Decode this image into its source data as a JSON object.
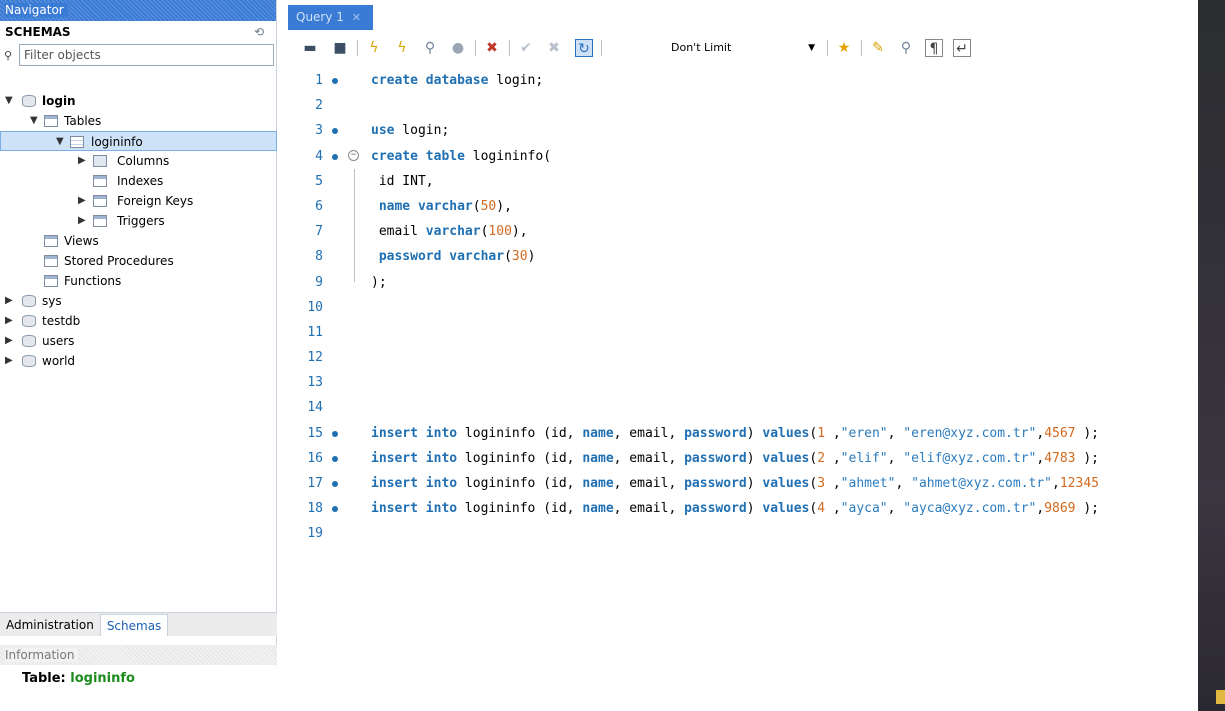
{
  "navigator": {
    "title": "Navigator",
    "schemas_label": "SCHEMAS",
    "filter_placeholder": "Filter objects",
    "tree": {
      "login": "login",
      "tables": "Tables",
      "logininfo": "logininfo",
      "columns": "Columns",
      "indexes": "Indexes",
      "foreign_keys": "Foreign Keys",
      "triggers": "Triggers",
      "views": "Views",
      "stored_procedures": "Stored Procedures",
      "functions": "Functions",
      "sys": "sys",
      "testdb": "testdb",
      "users": "users",
      "world": "world"
    },
    "bottom_tabs": [
      "Administration",
      "Schemas"
    ],
    "information_title": "Information",
    "info_table_prefix": "Table:",
    "info_table_name": "logininfo"
  },
  "editor": {
    "tab_title": "Query 1",
    "limit": "Don't Limit",
    "lines": [
      {
        "n": "1",
        "text": "create database login;"
      },
      {
        "n": "2",
        "text": ""
      },
      {
        "n": "3",
        "text": "use login;"
      },
      {
        "n": "4",
        "text": "create table logininfo("
      },
      {
        "n": "5",
        "text": " id INT,"
      },
      {
        "n": "6",
        "text": " name varchar(50),"
      },
      {
        "n": "7",
        "text": " email varchar(100),"
      },
      {
        "n": "8",
        "text": " password varchar(30)"
      },
      {
        "n": "9",
        "text": ");"
      },
      {
        "n": "10",
        "text": ""
      },
      {
        "n": "11",
        "text": ""
      },
      {
        "n": "12",
        "text": ""
      },
      {
        "n": "13",
        "text": ""
      },
      {
        "n": "14",
        "text": ""
      },
      {
        "n": "15",
        "text": "insert into logininfo (id, name, email, password) values(1 ,\"eren\", \"eren@xyz.com.tr\",4567 );"
      },
      {
        "n": "16",
        "text": "insert into logininfo (id, name, email, password) values(2 ,\"elif\", \"elif@xyz.com.tr\",4783 );"
      },
      {
        "n": "17",
        "text": "insert into logininfo (id, name, email, password) values(3 ,\"ahmet\", \"ahmet@xyz.com.tr\",12345"
      },
      {
        "n": "18",
        "text": "insert into logininfo (id, name, email, password) values(4 ,\"ayca\", \"ayca@xyz.com.tr\",9869 );"
      },
      {
        "n": "19",
        "text": ""
      }
    ]
  },
  "colors": {
    "accent": "#3a7bd5",
    "keyword": "#1f6fb3",
    "number": "#d2691e",
    "selection": "#cfe3f8"
  }
}
